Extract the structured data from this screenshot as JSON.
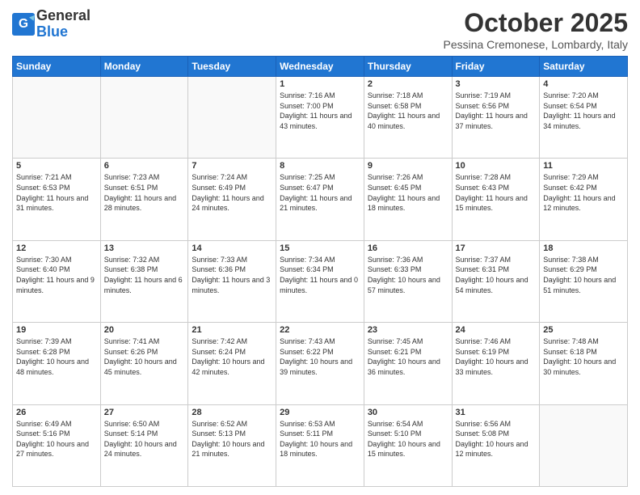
{
  "header": {
    "logo_general": "General",
    "logo_blue": "Blue",
    "month_title": "October 2025",
    "location": "Pessina Cremonese, Lombardy, Italy"
  },
  "weekdays": [
    "Sunday",
    "Monday",
    "Tuesday",
    "Wednesday",
    "Thursday",
    "Friday",
    "Saturday"
  ],
  "weeks": [
    [
      {
        "day": "",
        "info": ""
      },
      {
        "day": "",
        "info": ""
      },
      {
        "day": "",
        "info": ""
      },
      {
        "day": "1",
        "info": "Sunrise: 7:16 AM\nSunset: 7:00 PM\nDaylight: 11 hours\nand 43 minutes."
      },
      {
        "day": "2",
        "info": "Sunrise: 7:18 AM\nSunset: 6:58 PM\nDaylight: 11 hours\nand 40 minutes."
      },
      {
        "day": "3",
        "info": "Sunrise: 7:19 AM\nSunset: 6:56 PM\nDaylight: 11 hours\nand 37 minutes."
      },
      {
        "day": "4",
        "info": "Sunrise: 7:20 AM\nSunset: 6:54 PM\nDaylight: 11 hours\nand 34 minutes."
      }
    ],
    [
      {
        "day": "5",
        "info": "Sunrise: 7:21 AM\nSunset: 6:53 PM\nDaylight: 11 hours\nand 31 minutes."
      },
      {
        "day": "6",
        "info": "Sunrise: 7:23 AM\nSunset: 6:51 PM\nDaylight: 11 hours\nand 28 minutes."
      },
      {
        "day": "7",
        "info": "Sunrise: 7:24 AM\nSunset: 6:49 PM\nDaylight: 11 hours\nand 24 minutes."
      },
      {
        "day": "8",
        "info": "Sunrise: 7:25 AM\nSunset: 6:47 PM\nDaylight: 11 hours\nand 21 minutes."
      },
      {
        "day": "9",
        "info": "Sunrise: 7:26 AM\nSunset: 6:45 PM\nDaylight: 11 hours\nand 18 minutes."
      },
      {
        "day": "10",
        "info": "Sunrise: 7:28 AM\nSunset: 6:43 PM\nDaylight: 11 hours\nand 15 minutes."
      },
      {
        "day": "11",
        "info": "Sunrise: 7:29 AM\nSunset: 6:42 PM\nDaylight: 11 hours\nand 12 minutes."
      }
    ],
    [
      {
        "day": "12",
        "info": "Sunrise: 7:30 AM\nSunset: 6:40 PM\nDaylight: 11 hours\nand 9 minutes."
      },
      {
        "day": "13",
        "info": "Sunrise: 7:32 AM\nSunset: 6:38 PM\nDaylight: 11 hours\nand 6 minutes."
      },
      {
        "day": "14",
        "info": "Sunrise: 7:33 AM\nSunset: 6:36 PM\nDaylight: 11 hours\nand 3 minutes."
      },
      {
        "day": "15",
        "info": "Sunrise: 7:34 AM\nSunset: 6:34 PM\nDaylight: 11 hours\nand 0 minutes."
      },
      {
        "day": "16",
        "info": "Sunrise: 7:36 AM\nSunset: 6:33 PM\nDaylight: 10 hours\nand 57 minutes."
      },
      {
        "day": "17",
        "info": "Sunrise: 7:37 AM\nSunset: 6:31 PM\nDaylight: 10 hours\nand 54 minutes."
      },
      {
        "day": "18",
        "info": "Sunrise: 7:38 AM\nSunset: 6:29 PM\nDaylight: 10 hours\nand 51 minutes."
      }
    ],
    [
      {
        "day": "19",
        "info": "Sunrise: 7:39 AM\nSunset: 6:28 PM\nDaylight: 10 hours\nand 48 minutes."
      },
      {
        "day": "20",
        "info": "Sunrise: 7:41 AM\nSunset: 6:26 PM\nDaylight: 10 hours\nand 45 minutes."
      },
      {
        "day": "21",
        "info": "Sunrise: 7:42 AM\nSunset: 6:24 PM\nDaylight: 10 hours\nand 42 minutes."
      },
      {
        "day": "22",
        "info": "Sunrise: 7:43 AM\nSunset: 6:22 PM\nDaylight: 10 hours\nand 39 minutes."
      },
      {
        "day": "23",
        "info": "Sunrise: 7:45 AM\nSunset: 6:21 PM\nDaylight: 10 hours\nand 36 minutes."
      },
      {
        "day": "24",
        "info": "Sunrise: 7:46 AM\nSunset: 6:19 PM\nDaylight: 10 hours\nand 33 minutes."
      },
      {
        "day": "25",
        "info": "Sunrise: 7:48 AM\nSunset: 6:18 PM\nDaylight: 10 hours\nand 30 minutes."
      }
    ],
    [
      {
        "day": "26",
        "info": "Sunrise: 6:49 AM\nSunset: 5:16 PM\nDaylight: 10 hours\nand 27 minutes."
      },
      {
        "day": "27",
        "info": "Sunrise: 6:50 AM\nSunset: 5:14 PM\nDaylight: 10 hours\nand 24 minutes."
      },
      {
        "day": "28",
        "info": "Sunrise: 6:52 AM\nSunset: 5:13 PM\nDaylight: 10 hours\nand 21 minutes."
      },
      {
        "day": "29",
        "info": "Sunrise: 6:53 AM\nSunset: 5:11 PM\nDaylight: 10 hours\nand 18 minutes."
      },
      {
        "day": "30",
        "info": "Sunrise: 6:54 AM\nSunset: 5:10 PM\nDaylight: 10 hours\nand 15 minutes."
      },
      {
        "day": "31",
        "info": "Sunrise: 6:56 AM\nSunset: 5:08 PM\nDaylight: 10 hours\nand 12 minutes."
      },
      {
        "day": "",
        "info": ""
      }
    ]
  ]
}
